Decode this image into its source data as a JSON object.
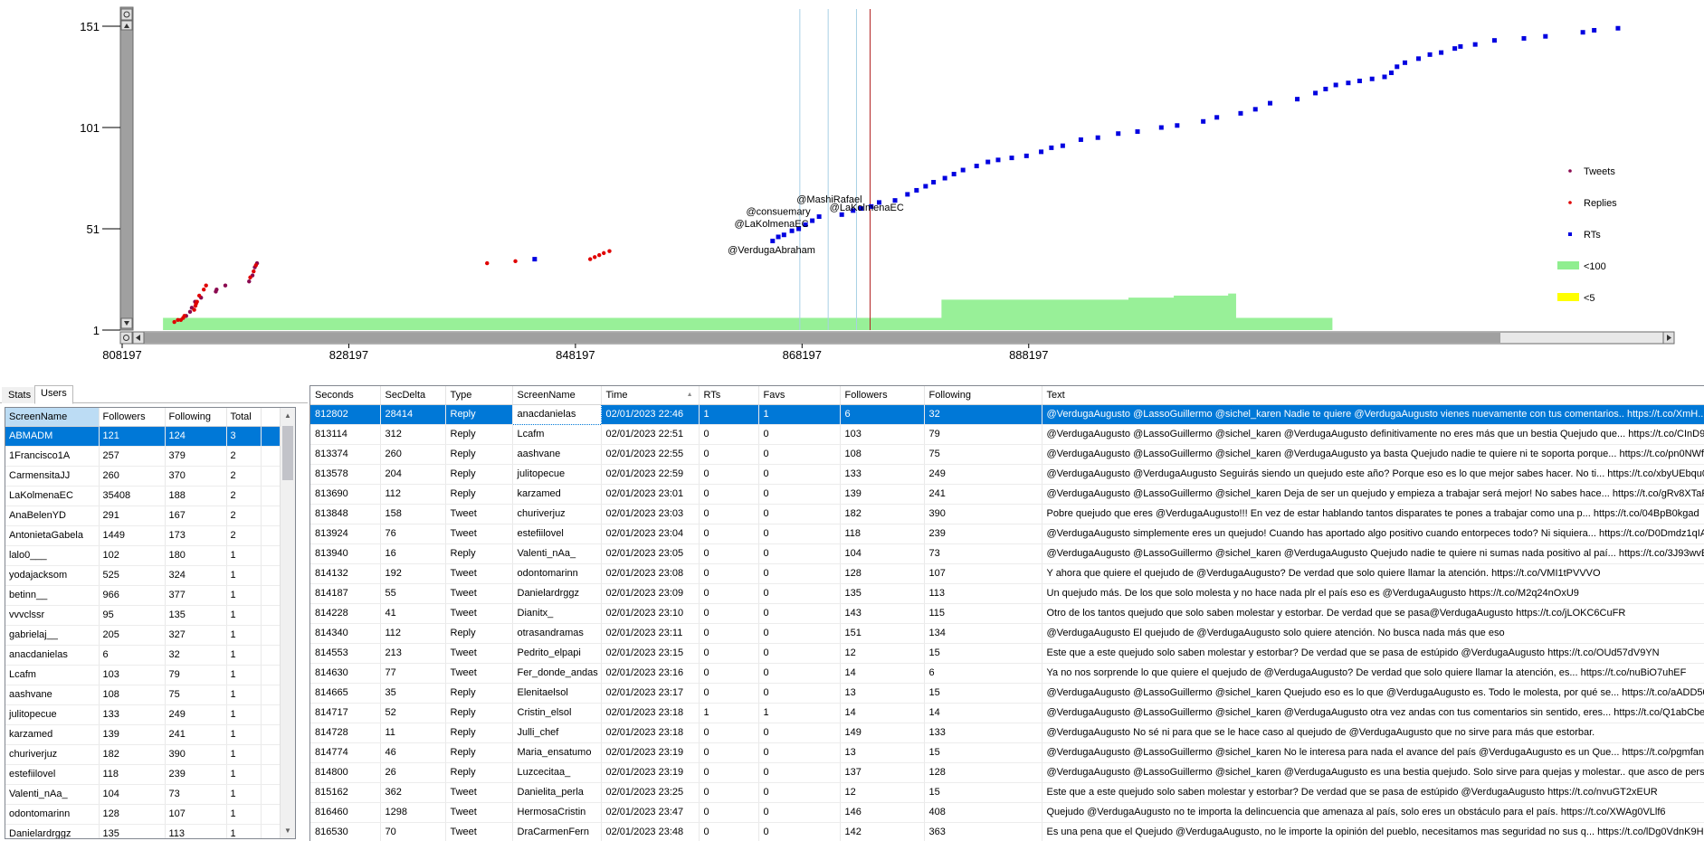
{
  "chart_data": {
    "type": "scatter",
    "x_ticks": [
      808197,
      828197,
      848197,
      868197,
      888197
    ],
    "y_ticks": [
      1,
      51,
      101,
      151
    ],
    "xlim": [
      808197,
      920000
    ],
    "ylim": [
      1,
      151
    ],
    "annotations": [
      {
        "text": "@MashiRafael",
        "x": 870600,
        "y": 64
      },
      {
        "text": "@consuemary",
        "x": 866100,
        "y": 58
      },
      {
        "text": "@LaKolmenaEC",
        "x": 865500,
        "y": 52
      },
      {
        "text": "@LaKolmenaEC",
        "x": 873900,
        "y": 60
      },
      {
        "text": "@VerdugaAbraham",
        "x": 865500,
        "y": 39
      }
    ],
    "vlines": [
      {
        "x": 868000,
        "color": "#a8d0e6"
      },
      {
        "x": 870500,
        "color": "#a8d0e6"
      },
      {
        "x": 873000,
        "color": "#a8d0e6"
      },
      {
        "x": 874200,
        "color": "#b22222"
      }
    ],
    "legend": [
      {
        "label": "Tweets",
        "color": "#8b0a50",
        "marker": "dot"
      },
      {
        "label": "Replies",
        "color": "#e00000",
        "marker": "dot"
      },
      {
        "label": "RTs",
        "color": "#0000e0",
        "marker": "square"
      },
      {
        "label": "<100",
        "color": "#90ee90",
        "marker": "rect"
      },
      {
        "label": "<5",
        "color": "#ffff00",
        "marker": "rect"
      }
    ],
    "area_lt100": [
      [
        811800,
        8
      ],
      [
        811800,
        7
      ],
      [
        815900,
        7
      ],
      [
        815900,
        8
      ],
      [
        815900,
        7
      ],
      [
        880500,
        7
      ],
      [
        880500,
        16
      ],
      [
        897000,
        17
      ],
      [
        901000,
        18
      ],
      [
        905800,
        19
      ],
      [
        906500,
        20
      ],
      [
        906500,
        7
      ],
      [
        915000,
        7
      ]
    ],
    "series": [
      {
        "name": "Tweets",
        "marker": "dot",
        "color": "#8b0a50",
        "points": [
          [
            813848,
            8
          ],
          [
            814187,
            10
          ],
          [
            814340,
            12
          ],
          [
            814630,
            15
          ],
          [
            815162,
            17
          ],
          [
            816460,
            20
          ],
          [
            816530,
            21
          ],
          [
            817300,
            23
          ],
          [
            819400,
            25
          ],
          [
            819700,
            28
          ],
          [
            819900,
            32
          ],
          [
            820100,
            34
          ]
        ]
      },
      {
        "name": "Replies",
        "marker": "dot",
        "color": "#e00000",
        "points": [
          [
            812802,
            5
          ],
          [
            813114,
            6
          ],
          [
            813374,
            6
          ],
          [
            813578,
            7
          ],
          [
            813690,
            8
          ],
          [
            814553,
            11
          ],
          [
            814665,
            13
          ],
          [
            814717,
            14
          ],
          [
            814800,
            15
          ],
          [
            815000,
            18
          ],
          [
            815400,
            21
          ],
          [
            815600,
            23
          ],
          [
            819500,
            27
          ],
          [
            819800,
            30
          ],
          [
            820000,
            33
          ],
          [
            840400,
            34
          ],
          [
            842900,
            35
          ],
          [
            849500,
            36
          ],
          [
            849900,
            37
          ],
          [
            850300,
            38
          ],
          [
            850700,
            39
          ],
          [
            851200,
            40
          ]
        ]
      },
      {
        "name": "RTs",
        "marker": "square",
        "color": "#0000e0",
        "points": [
          [
            844600,
            36
          ],
          [
            865600,
            45
          ],
          [
            866100,
            47
          ],
          [
            866600,
            48
          ],
          [
            867300,
            50
          ],
          [
            867900,
            51
          ],
          [
            868500,
            53
          ],
          [
            869100,
            55
          ],
          [
            869700,
            57
          ],
          [
            871700,
            58
          ],
          [
            872700,
            60
          ],
          [
            873400,
            61
          ],
          [
            874300,
            62
          ],
          [
            875000,
            64
          ],
          [
            876400,
            65
          ],
          [
            877500,
            68
          ],
          [
            878300,
            70
          ],
          [
            879100,
            72
          ],
          [
            879800,
            74
          ],
          [
            880800,
            76
          ],
          [
            881600,
            78
          ],
          [
            882400,
            80
          ],
          [
            883600,
            82
          ],
          [
            884600,
            84
          ],
          [
            885500,
            85
          ],
          [
            886700,
            86
          ],
          [
            888000,
            87
          ],
          [
            889300,
            89
          ],
          [
            890200,
            91
          ],
          [
            891200,
            92
          ],
          [
            892800,
            95
          ],
          [
            894300,
            96
          ],
          [
            896100,
            98
          ],
          [
            897800,
            99
          ],
          [
            899900,
            101
          ],
          [
            901300,
            102
          ],
          [
            903600,
            104
          ],
          [
            904800,
            106
          ],
          [
            906900,
            108
          ],
          [
            908200,
            110
          ],
          [
            909500,
            113
          ],
          [
            911900,
            115
          ],
          [
            913500,
            118
          ],
          [
            914400,
            120
          ],
          [
            915300,
            122
          ],
          [
            916400,
            123
          ],
          [
            917400,
            124
          ],
          [
            918500,
            125
          ],
          [
            919600,
            126
          ],
          [
            920200,
            128
          ],
          [
            920700,
            131
          ],
          [
            921400,
            133
          ],
          [
            922600,
            135
          ],
          [
            923600,
            137
          ],
          [
            924600,
            138
          ],
          [
            925800,
            140
          ],
          [
            926300,
            141
          ],
          [
            927600,
            142
          ],
          [
            929300,
            144
          ],
          [
            931900,
            145
          ],
          [
            933800,
            146
          ],
          [
            937100,
            148
          ],
          [
            938100,
            149
          ],
          [
            940200,
            150
          ]
        ]
      }
    ]
  },
  "tabs": [
    {
      "label": "Stats",
      "active": false
    },
    {
      "label": "Users",
      "active": true
    }
  ],
  "users_table": {
    "headers": [
      "ScreenName",
      "Followers",
      "Following",
      "Total"
    ],
    "rows": [
      [
        "ABMADM",
        "121",
        "124",
        "3"
      ],
      [
        "1Francisco1A",
        "257",
        "379",
        "2"
      ],
      [
        "CarmensitaJJ",
        "260",
        "370",
        "2"
      ],
      [
        "LaKolmenaEC",
        "35408",
        "188",
        "2"
      ],
      [
        "AnaBelenYD",
        "291",
        "167",
        "2"
      ],
      [
        "AntonietaGabela",
        "1449",
        "173",
        "2"
      ],
      [
        "lalo0___",
        "102",
        "180",
        "1"
      ],
      [
        "yodajacksom",
        "525",
        "324",
        "1"
      ],
      [
        "betinn__",
        "966",
        "377",
        "1"
      ],
      [
        "vvvclssr",
        "95",
        "135",
        "1"
      ],
      [
        "gabrielaj__",
        "205",
        "327",
        "1"
      ],
      [
        "anacdanielas",
        "6",
        "32",
        "1"
      ],
      [
        "Lcafm",
        "103",
        "79",
        "1"
      ],
      [
        "aashvane",
        "108",
        "75",
        "1"
      ],
      [
        "julitopecue",
        "133",
        "249",
        "1"
      ],
      [
        "karzamed",
        "139",
        "241",
        "1"
      ],
      [
        "churiverjuz",
        "182",
        "390",
        "1"
      ],
      [
        "estefiilovel",
        "118",
        "239",
        "1"
      ],
      [
        "Valenti_nAa_",
        "104",
        "73",
        "1"
      ],
      [
        "odontomarinn",
        "128",
        "107",
        "1"
      ],
      [
        "Danielardrggz",
        "135",
        "113",
        "1"
      ]
    ]
  },
  "tweets_table": {
    "headers": [
      "Seconds",
      "SecDelta",
      "Type",
      "ScreenName",
      "Time",
      "RTs",
      "Favs",
      "Followers",
      "Following",
      "Text"
    ],
    "rows": [
      [
        "812802",
        "28414",
        "Reply",
        "anacdanielas",
        "02/01/2023 22:46",
        "1",
        "1",
        "6",
        "32",
        "@VerdugaAugusto @LassoGuillermo @sichel_karen Nadie te quiere @VerdugaAugusto vienes nuevamente con tus comentarios.. https://t.co/XmH..."
      ],
      [
        "813114",
        "312",
        "Reply",
        "Lcafm",
        "02/01/2023 22:51",
        "0",
        "0",
        "103",
        "79",
        "@VerdugaAugusto @LassoGuillermo @sichel_karen @VerdugaAugusto definitivamente no eres más que un bestia Quejudo que... https://t.co/CInD9I..."
      ],
      [
        "813374",
        "260",
        "Reply",
        "aashvane",
        "02/01/2023 22:55",
        "0",
        "0",
        "108",
        "75",
        "@VerdugaAugusto @LassoGuillermo @sichel_karen @VerdugaAugusto ya basta Quejudo nadie te quiere ni te soporta porque... https://t.co/pn0NWf..."
      ],
      [
        "813578",
        "204",
        "Reply",
        "julitopecue",
        "02/01/2023 22:59",
        "0",
        "0",
        "133",
        "249",
        "@VerdugaAugusto @VerdugaAugusto Seguirás siendo un quejudo este año?  Porque eso es lo que mejor sabes hacer. No ti... https://t.co/xbyUEbqu0T"
      ],
      [
        "813690",
        "112",
        "Reply",
        "karzamed",
        "02/01/2023 23:01",
        "0",
        "0",
        "139",
        "241",
        "@VerdugaAugusto @LassoGuillermo @sichel_karen Deja de ser un quejudo y empieza a trabajar será mejor! No sabes hace... https://t.co/gRv8XTaFo8"
      ],
      [
        "813848",
        "158",
        "Tweet",
        "churiverjuz",
        "02/01/2023 23:03",
        "0",
        "0",
        "182",
        "390",
        "Pobre quejudo que eres @VerdugaAugusto!!! En vez de estar hablando tantos disparates te pones a trabajar como una p... https://t.co/04BpB0kgad"
      ],
      [
        "813924",
        "76",
        "Tweet",
        "estefiilovel",
        "02/01/2023 23:04",
        "0",
        "0",
        "118",
        "239",
        "@VerdugaAugusto simplemente eres un quejudo! Cuando has aportado algo positivo cuando entorpeces todo? Ni siquiera... https://t.co/D0Dmdz1qIA"
      ],
      [
        "813940",
        "16",
        "Reply",
        "Valenti_nAa_",
        "02/01/2023 23:05",
        "0",
        "0",
        "104",
        "73",
        "@VerdugaAugusto @LassoGuillermo @sichel_karen @VerdugaAugusto Quejudo nadie te quiere ni sumas nada positivo al paí... https://t.co/3J93wvE..."
      ],
      [
        "814132",
        "192",
        "Tweet",
        "odontomarinn",
        "02/01/2023 23:08",
        "0",
        "0",
        "128",
        "107",
        "Y ahora que quiere el quejudo de @VerdugaAugusto? De verdad que solo quiere llamar la atención. https://t.co/VMI1tPVVVO"
      ],
      [
        "814187",
        "55",
        "Tweet",
        "Danielardrggz",
        "02/01/2023 23:09",
        "0",
        "0",
        "135",
        "113",
        "Un quejudo más. De los que solo molesta y no hace nada plr el país eso es @VerdugaAugusto https://t.co/M2q24nOxU9"
      ],
      [
        "814228",
        "41",
        "Tweet",
        "Dianitx_",
        "02/01/2023 23:10",
        "0",
        "0",
        "143",
        "115",
        "Otro de los tantos quejudo que solo saben molestar y estorbar. De verdad que se pasa@VerdugaAugusto https://t.co/jLOKC6CuFR"
      ],
      [
        "814340",
        "112",
        "Reply",
        "otrasandramas",
        "02/01/2023 23:11",
        "0",
        "0",
        "151",
        "134",
        "@VerdugaAugusto El quejudo de @VerdugaAugusto solo quiere atención. No busca nada más que eso"
      ],
      [
        "814553",
        "213",
        "Tweet",
        "Pedrito_elpapi",
        "02/01/2023 23:15",
        "0",
        "0",
        "12",
        "15",
        "Este que a este quejudo  solo saben molestar y estorbar? De verdad que se pasa de estúpido @VerdugaAugusto https://t.co/OUd57dV9YN"
      ],
      [
        "814630",
        "77",
        "Tweet",
        "Fer_donde_andas",
        "02/01/2023 23:16",
        "0",
        "0",
        "14",
        "6",
        "Ya no nos sorprende lo que quiere el quejudo de @VerdugaAugusto? De verdad que solo quiere llamar la atención, es... https://t.co/nuBiO7uhEF"
      ],
      [
        "814665",
        "35",
        "Reply",
        "Elenitaelsol",
        "02/01/2023 23:17",
        "0",
        "0",
        "13",
        "15",
        "@VerdugaAugusto @LassoGuillermo @sichel_karen Quejudo eso es lo que @VerdugaAugusto es. Todo le molesta, por qué se... https://t.co/aADD50..."
      ],
      [
        "814717",
        "52",
        "Reply",
        "Cristin_elsol",
        "02/01/2023 23:18",
        "1",
        "1",
        "14",
        "14",
        "@VerdugaAugusto @LassoGuillermo @sichel_karen @VerdugaAugusto otra vez andas con tus comentarios sin sentido, eres... https://t.co/Q1abCber..."
      ],
      [
        "814728",
        "11",
        "Reply",
        "Julli_chef",
        "02/01/2023 23:18",
        "0",
        "0",
        "149",
        "133",
        "@VerdugaAugusto No sé ni para que se le hace caso al quejudo de @VerdugaAugusto que no sirve para más que estorbar."
      ],
      [
        "814774",
        "46",
        "Reply",
        "Maria_ensatumo",
        "02/01/2023 23:19",
        "0",
        "0",
        "13",
        "15",
        "@VerdugaAugusto @LassoGuillermo @sichel_karen No le interesa para nada el avance del país @VerdugaAugusto es un Que... https://t.co/pgmfan..."
      ],
      [
        "814800",
        "26",
        "Reply",
        "Luzcecitaa_",
        "02/01/2023 23:19",
        "0",
        "0",
        "137",
        "128",
        "@VerdugaAugusto @LassoGuillermo @sichel_karen @VerdugaAugusto es una bestia quejudo. Solo sirve para quejas y molestar.. que asco de persona"
      ],
      [
        "815162",
        "362",
        "Tweet",
        "Danielita_perla",
        "02/01/2023 23:25",
        "0",
        "0",
        "12",
        "15",
        "Este que a este quejudo  solo saben molestar y estorbar? De verdad que se pasa de estúpido @VerdugaAugusto https://t.co/nvuGT2xEUR"
      ],
      [
        "816460",
        "1298",
        "Tweet",
        "HermosaCristin",
        "02/01/2023 23:47",
        "0",
        "0",
        "146",
        "408",
        "Quejudo @VerdugaAugusto no te importa la delincuencia que amenaza al país, solo eres un obstáculo para el país. https://t.co/XWAg0VLlf6"
      ],
      [
        "816530",
        "70",
        "Tweet",
        "DraCarmenFern",
        "02/01/2023 23:48",
        "0",
        "0",
        "142",
        "363",
        "Es una pena que el Quejudo @VerdugaAugusto, no le importe la opinión del pueblo, necesitamos mas seguridad no sus q... https://t.co/lDg0VdnK9H"
      ]
    ]
  }
}
